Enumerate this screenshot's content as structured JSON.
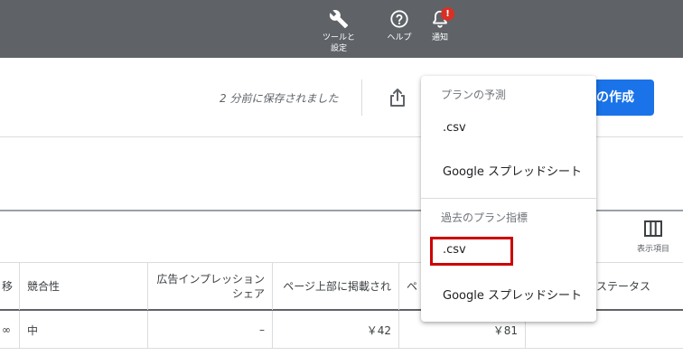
{
  "topbar": {
    "items": [
      {
        "label": "ツールと\n設定",
        "icon": "wrench-icon"
      },
      {
        "label": "ヘルプ",
        "icon": "help-icon"
      },
      {
        "label": "通知",
        "icon": "bell-icon",
        "badge": "!"
      }
    ]
  },
  "toolbar": {
    "saved_text": "2 分前に保存されました",
    "create_button_label": "ンの作成"
  },
  "columns_toggle_label": "表示項目",
  "table": {
    "headers": [
      "移",
      "競合性",
      "広告インプレッション\nシェア",
      "ページ上部に掲載され",
      "ペ",
      "ステータス"
    ],
    "rows": [
      [
        "∞",
        "中",
        "–",
        "￥42",
        "￥81",
        ""
      ]
    ]
  },
  "menu": {
    "section1_header": "プランの予測",
    "section1_items": [
      ".csv",
      "Google スプレッドシート"
    ],
    "section2_header": "過去のプラン指標",
    "section2_items": [
      ".csv",
      "Google スプレッドシート"
    ]
  },
  "colors": {
    "topbar": "#5f6368",
    "primary": "#1a73e8",
    "badge": "#d93025",
    "highlight": "#cc0000"
  }
}
